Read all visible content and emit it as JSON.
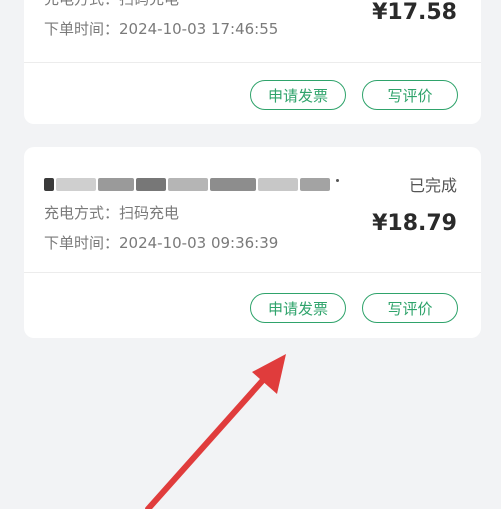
{
  "orders": [
    {
      "charge_method": "充电方式：扫码充电",
      "order_time": "下单时间：2024-10-03 17:46:55",
      "price": "¥17.58",
      "invoice_button": "申请发票",
      "review_button": "写评价"
    },
    {
      "status": "已完成",
      "charge_method": "充电方式：扫码充电",
      "order_time": "下单时间：2024-10-03 09:36:39",
      "price": "¥18.79",
      "invoice_button": "申请发票",
      "review_button": "写评价"
    }
  ],
  "colors": {
    "accent": "#2fa36b",
    "arrow": "#e03c3c",
    "background": "#f2f3f5"
  }
}
